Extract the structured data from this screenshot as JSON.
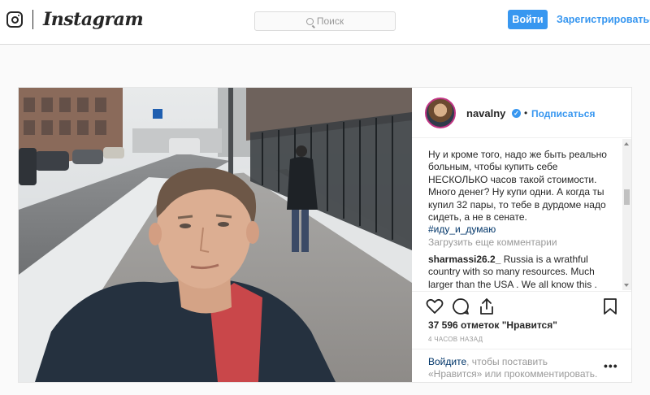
{
  "nav": {
    "logo_text": "Instagram",
    "search_placeholder": "Поиск",
    "login_label": "Войти",
    "signup_label": "Зарегистрироваться"
  },
  "post": {
    "username": "navalny",
    "verified_mark": "✓",
    "separator": "•",
    "follow_label": "Подписаться",
    "caption_text": "Ну и кроме того, надо же быть реально больным, чтобы купить себе НЕСКОЛЬКО часов такой стоимости.\nМного денег? Ну купи одни. А когда ты купил 32 пары, то тебе в дурдоме надо сидеть, а не в сенате.",
    "hashtag": "#иду_и_думаю",
    "load_more_label": "Загрузить еще комментарии",
    "comments": [
      {
        "author": "sharmassi26.2_",
        "text": "Russia is a wrathful country with so many resources. Much larger than the USA . We all know this . But Putin and"
      }
    ],
    "likes_text": "37 596 отметок \"Нравится\"",
    "time_text": "4 ЧАСОВ НАЗАД",
    "login_prompt": {
      "link": "Войдите",
      "text": ", чтобы поставить «Нравится» или прокомментировать."
    },
    "more_label": "•••"
  },
  "colors": {
    "accent": "#3897f0",
    "border": "#dbdbdb",
    "muted": "#999999",
    "link_dark": "#003569"
  },
  "icons": [
    "instagram-glyph-icon",
    "search-icon",
    "verified-badge-icon",
    "heart-icon",
    "comment-icon",
    "share-icon",
    "bookmark-icon",
    "more-options-icon"
  ]
}
